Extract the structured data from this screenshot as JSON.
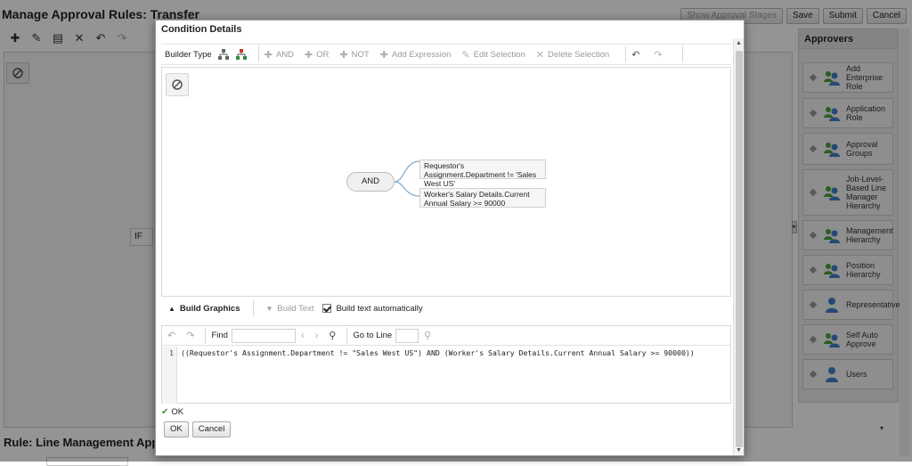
{
  "page": {
    "title": "Manage Approval Rules: Transfer",
    "top_buttons": {
      "show_approval_stages": "Show Approval Stages",
      "save": "Save",
      "submit": "Submit",
      "cancel": "Cancel"
    },
    "if_label": "IF",
    "rule_title": "Rule: Line Management Approv"
  },
  "approvers": {
    "title": "Approvers",
    "items": [
      {
        "label": "Add Enterprise Role"
      },
      {
        "label": "Application Role"
      },
      {
        "label": "Approval Groups"
      },
      {
        "label": "Job-Level-Based Line Manager Hierarchy"
      },
      {
        "label": "Management Hierarchy"
      },
      {
        "label": "Position Hierarchy"
      },
      {
        "label": "Representative"
      },
      {
        "label": "Self Auto Approve"
      },
      {
        "label": "Users"
      }
    ]
  },
  "dialog": {
    "title": "Condition Details",
    "toolbar": {
      "builder_type": "Builder Type",
      "and": "AND",
      "or": "OR",
      "not": "NOT",
      "add_expression": "Add Expression",
      "edit_selection": "Edit Selection",
      "delete_selection": "Delete Selection"
    },
    "tree": {
      "root": "AND",
      "conditions": [
        "Requestor's Assignment.Department != 'Sales West US'",
        "Worker's Salary Details.Current Annual Salary >= 90000"
      ]
    },
    "tabs": {
      "build_graphics": "Build Graphics",
      "build_text": "Build Text",
      "build_text_auto": "Build text automatically"
    },
    "editor": {
      "find": "Find",
      "go_to_line": "Go to Line",
      "line_number": "1",
      "code": "((Requestor's Assignment.Department != \"Sales West US\") AND (Worker's Salary Details.Current Annual Salary >= 90000))"
    },
    "status": "OK",
    "buttons": {
      "ok": "OK",
      "cancel": "Cancel"
    }
  },
  "colors": {
    "overlay": "#000000",
    "ok_green": "#3a9a2a",
    "approver_icon_blue": "#3f7fc8",
    "approver_icon_green": "#4aa33a"
  }
}
